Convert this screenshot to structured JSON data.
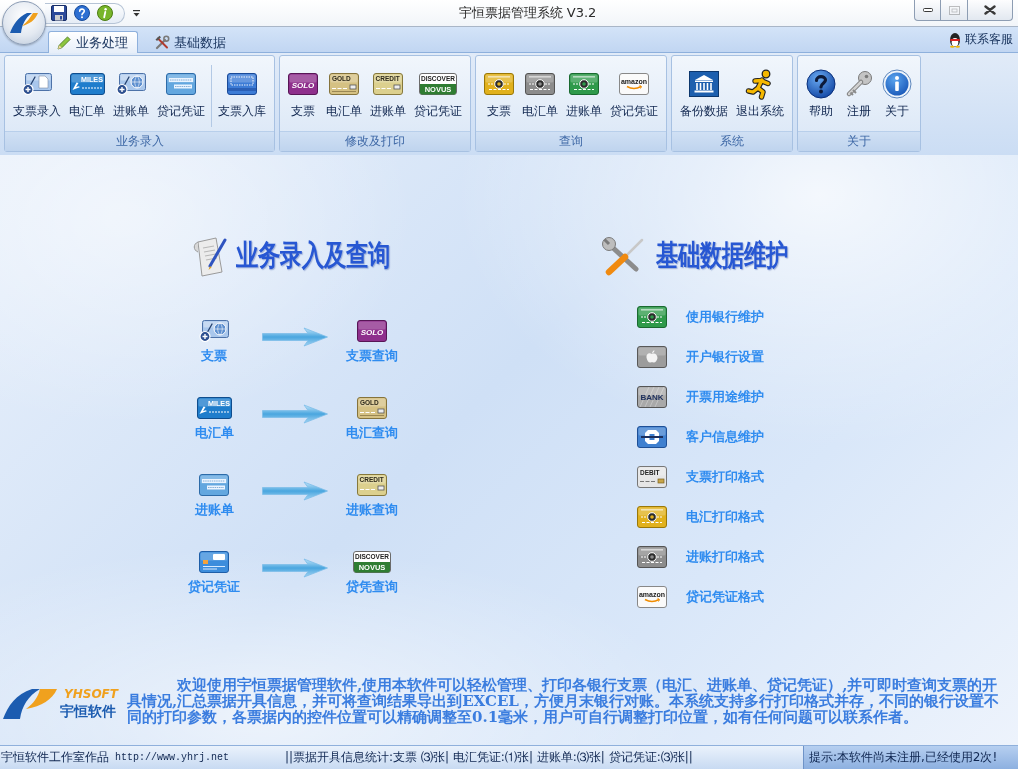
{
  "window": {
    "title": "宇恒票据管理系统 V3.2",
    "controls": [
      {
        "kind": "minimize",
        "disabled": false
      },
      {
        "kind": "maximize",
        "disabled": true
      },
      {
        "kind": "close",
        "disabled": false
      }
    ]
  },
  "ribbon": {
    "tabs": [
      {
        "label": "业务处理",
        "selected": true
      },
      {
        "label": "基础数据",
        "selected": false
      }
    ],
    "contact": "联系客服",
    "groups": [
      {
        "label": "业务录入",
        "sections": [
          [
            {
              "label": "支票录入"
            },
            {
              "label": "电汇单",
              "card_text": [
                "MILES"
              ]
            },
            {
              "label": "进账单"
            },
            {
              "label": "贷记凭证"
            }
          ],
          [
            {
              "label": "支票入库"
            }
          ]
        ]
      },
      {
        "label": "修改及打印",
        "sections": [
          [
            {
              "label": "支票",
              "card_text": [
                "SOLO"
              ]
            },
            {
              "label": "电汇单",
              "card_text": [
                "GOLD"
              ]
            },
            {
              "label": "进账单",
              "card_text": [
                "CREDIT"
              ]
            },
            {
              "label": "贷记凭证",
              "card_text": [
                "DISCOVER",
                "NOVUS"
              ]
            }
          ]
        ]
      },
      {
        "label": "查询",
        "sections": [
          [
            {
              "label": "支票"
            },
            {
              "label": "电汇单"
            },
            {
              "label": "进账单"
            },
            {
              "label": "贷记凭证",
              "card_text": [
                "amazon"
              ]
            }
          ]
        ]
      },
      {
        "label": "系统",
        "sections": [
          [
            {
              "label": "备份数据"
            },
            {
              "label": "退出系统"
            }
          ]
        ]
      },
      {
        "label": "关于",
        "sections": [
          [
            {
              "label": "帮助"
            },
            {
              "label": "注册"
            },
            {
              "label": "关于"
            }
          ]
        ]
      }
    ]
  },
  "business_flow": {
    "title": "业务录入及查询",
    "rows": [
      {
        "entry": {
          "label": "支票"
        },
        "query": {
          "label": "支票查询",
          "card_text": [
            "SOLO"
          ]
        }
      },
      {
        "entry": {
          "label": "电汇单",
          "card_text": [
            "MILES"
          ]
        },
        "query": {
          "label": "电汇查询",
          "card_text": [
            "GOLD"
          ]
        }
      },
      {
        "entry": {
          "label": "进账单"
        },
        "query": {
          "label": "进账查询",
          "card_text": [
            "CREDIT"
          ]
        }
      },
      {
        "entry": {
          "label": "贷记凭证"
        },
        "query": {
          "label": "贷凭查询",
          "card_text": [
            "DISCOVER",
            "NOVUS"
          ]
        }
      }
    ]
  },
  "base_data": {
    "title": "基础数据维护",
    "items": [
      {
        "label": "使用银行维护"
      },
      {
        "label": "开户银行设置"
      },
      {
        "label": "开票用途维护",
        "card_text": [
          "BANK"
        ]
      },
      {
        "label": "客户信息维护"
      },
      {
        "label": "支票打印格式",
        "card_text": [
          "DEBIT"
        ]
      },
      {
        "label": "电汇打印格式"
      },
      {
        "label": "进账打印格式"
      },
      {
        "label": "贷记凭证格式",
        "card_text": [
          "amazon"
        ]
      }
    ]
  },
  "intro": {
    "logo": {
      "brand": "YHSOFT",
      "name": "宇恒软件"
    },
    "text": "欢迎使用宇恒票据管理软件,使用本软件可以轻松管理、打印各银行支票（电汇、进账单、贷记凭证）,并可即时查询支票的开具情况,汇总票据开具信息，并可将查询结果导出到EXCEL，方便月末银行对账。本系统支持多行打印格式并存，不同的银行设置不同的打印参数，各票据内的控件位置可以精确调整至0.1毫米，用户可自行调整打印位置，如有任何问题可以联系作者。"
  },
  "status_bar": {
    "credit": "宇恒软件工作室作品",
    "url": "http://www.yhrj.net",
    "stats": "||票据开具信息统计:支票 ⑶张| 电汇凭证:⑴张| 进账单:⑶张| 贷记凭证:⑶张||",
    "notice": "提示:本软件尚未注册,已经使用2次!"
  }
}
